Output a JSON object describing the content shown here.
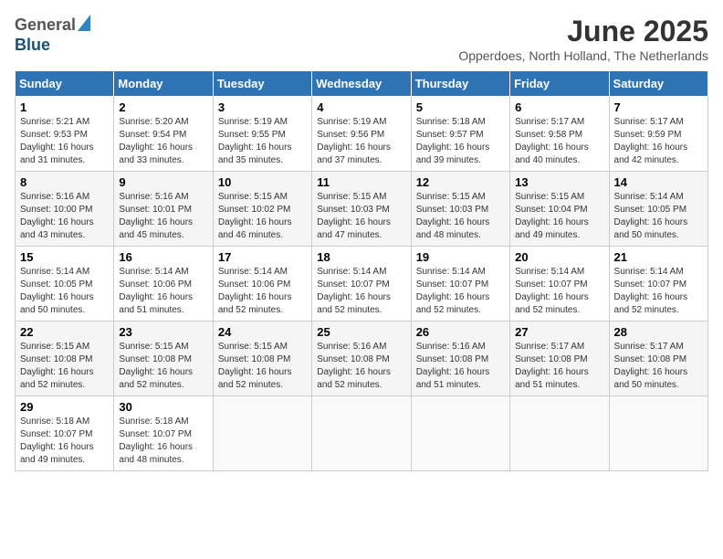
{
  "header": {
    "logo_general": "General",
    "logo_blue": "Blue",
    "month_title": "June 2025",
    "location": "Opperdoes, North Holland, The Netherlands"
  },
  "weekdays": [
    "Sunday",
    "Monday",
    "Tuesday",
    "Wednesday",
    "Thursday",
    "Friday",
    "Saturday"
  ],
  "weeks": [
    [
      {
        "day": "1",
        "sunrise": "Sunrise: 5:21 AM",
        "sunset": "Sunset: 9:53 PM",
        "daylight": "Daylight: 16 hours and 31 minutes."
      },
      {
        "day": "2",
        "sunrise": "Sunrise: 5:20 AM",
        "sunset": "Sunset: 9:54 PM",
        "daylight": "Daylight: 16 hours and 33 minutes."
      },
      {
        "day": "3",
        "sunrise": "Sunrise: 5:19 AM",
        "sunset": "Sunset: 9:55 PM",
        "daylight": "Daylight: 16 hours and 35 minutes."
      },
      {
        "day": "4",
        "sunrise": "Sunrise: 5:19 AM",
        "sunset": "Sunset: 9:56 PM",
        "daylight": "Daylight: 16 hours and 37 minutes."
      },
      {
        "day": "5",
        "sunrise": "Sunrise: 5:18 AM",
        "sunset": "Sunset: 9:57 PM",
        "daylight": "Daylight: 16 hours and 39 minutes."
      },
      {
        "day": "6",
        "sunrise": "Sunrise: 5:17 AM",
        "sunset": "Sunset: 9:58 PM",
        "daylight": "Daylight: 16 hours and 40 minutes."
      },
      {
        "day": "7",
        "sunrise": "Sunrise: 5:17 AM",
        "sunset": "Sunset: 9:59 PM",
        "daylight": "Daylight: 16 hours and 42 minutes."
      }
    ],
    [
      {
        "day": "8",
        "sunrise": "Sunrise: 5:16 AM",
        "sunset": "Sunset: 10:00 PM",
        "daylight": "Daylight: 16 hours and 43 minutes."
      },
      {
        "day": "9",
        "sunrise": "Sunrise: 5:16 AM",
        "sunset": "Sunset: 10:01 PM",
        "daylight": "Daylight: 16 hours and 45 minutes."
      },
      {
        "day": "10",
        "sunrise": "Sunrise: 5:15 AM",
        "sunset": "Sunset: 10:02 PM",
        "daylight": "Daylight: 16 hours and 46 minutes."
      },
      {
        "day": "11",
        "sunrise": "Sunrise: 5:15 AM",
        "sunset": "Sunset: 10:03 PM",
        "daylight": "Daylight: 16 hours and 47 minutes."
      },
      {
        "day": "12",
        "sunrise": "Sunrise: 5:15 AM",
        "sunset": "Sunset: 10:03 PM",
        "daylight": "Daylight: 16 hours and 48 minutes."
      },
      {
        "day": "13",
        "sunrise": "Sunrise: 5:15 AM",
        "sunset": "Sunset: 10:04 PM",
        "daylight": "Daylight: 16 hours and 49 minutes."
      },
      {
        "day": "14",
        "sunrise": "Sunrise: 5:14 AM",
        "sunset": "Sunset: 10:05 PM",
        "daylight": "Daylight: 16 hours and 50 minutes."
      }
    ],
    [
      {
        "day": "15",
        "sunrise": "Sunrise: 5:14 AM",
        "sunset": "Sunset: 10:05 PM",
        "daylight": "Daylight: 16 hours and 50 minutes."
      },
      {
        "day": "16",
        "sunrise": "Sunrise: 5:14 AM",
        "sunset": "Sunset: 10:06 PM",
        "daylight": "Daylight: 16 hours and 51 minutes."
      },
      {
        "day": "17",
        "sunrise": "Sunrise: 5:14 AM",
        "sunset": "Sunset: 10:06 PM",
        "daylight": "Daylight: 16 hours and 52 minutes."
      },
      {
        "day": "18",
        "sunrise": "Sunrise: 5:14 AM",
        "sunset": "Sunset: 10:07 PM",
        "daylight": "Daylight: 16 hours and 52 minutes."
      },
      {
        "day": "19",
        "sunrise": "Sunrise: 5:14 AM",
        "sunset": "Sunset: 10:07 PM",
        "daylight": "Daylight: 16 hours and 52 minutes."
      },
      {
        "day": "20",
        "sunrise": "Sunrise: 5:14 AM",
        "sunset": "Sunset: 10:07 PM",
        "daylight": "Daylight: 16 hours and 52 minutes."
      },
      {
        "day": "21",
        "sunrise": "Sunrise: 5:14 AM",
        "sunset": "Sunset: 10:07 PM",
        "daylight": "Daylight: 16 hours and 52 minutes."
      }
    ],
    [
      {
        "day": "22",
        "sunrise": "Sunrise: 5:15 AM",
        "sunset": "Sunset: 10:08 PM",
        "daylight": "Daylight: 16 hours and 52 minutes."
      },
      {
        "day": "23",
        "sunrise": "Sunrise: 5:15 AM",
        "sunset": "Sunset: 10:08 PM",
        "daylight": "Daylight: 16 hours and 52 minutes."
      },
      {
        "day": "24",
        "sunrise": "Sunrise: 5:15 AM",
        "sunset": "Sunset: 10:08 PM",
        "daylight": "Daylight: 16 hours and 52 minutes."
      },
      {
        "day": "25",
        "sunrise": "Sunrise: 5:16 AM",
        "sunset": "Sunset: 10:08 PM",
        "daylight": "Daylight: 16 hours and 52 minutes."
      },
      {
        "day": "26",
        "sunrise": "Sunrise: 5:16 AM",
        "sunset": "Sunset: 10:08 PM",
        "daylight": "Daylight: 16 hours and 51 minutes."
      },
      {
        "day": "27",
        "sunrise": "Sunrise: 5:17 AM",
        "sunset": "Sunset: 10:08 PM",
        "daylight": "Daylight: 16 hours and 51 minutes."
      },
      {
        "day": "28",
        "sunrise": "Sunrise: 5:17 AM",
        "sunset": "Sunset: 10:08 PM",
        "daylight": "Daylight: 16 hours and 50 minutes."
      }
    ],
    [
      {
        "day": "29",
        "sunrise": "Sunrise: 5:18 AM",
        "sunset": "Sunset: 10:07 PM",
        "daylight": "Daylight: 16 hours and 49 minutes."
      },
      {
        "day": "30",
        "sunrise": "Sunrise: 5:18 AM",
        "sunset": "Sunset: 10:07 PM",
        "daylight": "Daylight: 16 hours and 48 minutes."
      },
      null,
      null,
      null,
      null,
      null
    ]
  ]
}
